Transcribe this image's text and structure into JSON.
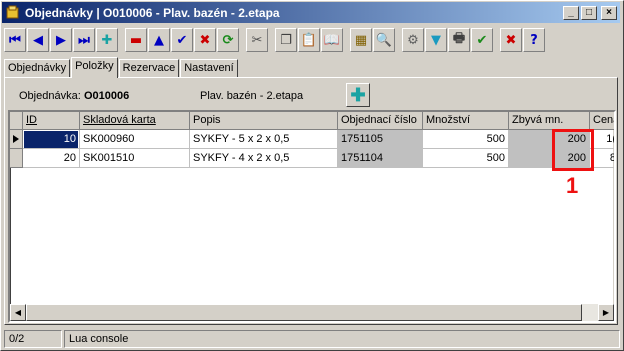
{
  "window": {
    "title": "Objednávky | O010006 - Plav. bazén - 2.etapa",
    "controls": {
      "minimize": "_",
      "maximize": "□",
      "close": "×"
    }
  },
  "toolbar": [
    {
      "name": "first-record-button",
      "glyph": "⏮",
      "color": "#0000c0"
    },
    {
      "name": "prev-record-button",
      "glyph": "◀",
      "color": "#0000c0"
    },
    {
      "name": "next-record-button",
      "glyph": "▶",
      "color": "#0000c0"
    },
    {
      "name": "last-record-button",
      "glyph": "⏭",
      "color": "#0000c0"
    },
    {
      "name": "add-record-button",
      "glyph": "✚",
      "color": "#1aa3a3"
    },
    {
      "name": "delete-record-button",
      "glyph": "▬",
      "color": "#cc0000"
    },
    {
      "name": "up-button",
      "glyph": "▲",
      "color": "#0000c0"
    },
    {
      "name": "confirm-button",
      "glyph": "✔",
      "color": "#0000c0"
    },
    {
      "name": "cancel-edit-button",
      "glyph": "✖",
      "color": "#cc0000"
    },
    {
      "name": "refresh-button",
      "glyph": "⟳",
      "color": "#1a8a1a"
    },
    {
      "name": "cut-button",
      "glyph": "✂",
      "color": "#505050"
    },
    {
      "name": "copy-button",
      "glyph": "❐",
      "color": "#404040"
    },
    {
      "name": "paste-button",
      "glyph": "📋",
      "color": "#806000"
    },
    {
      "name": "book-button",
      "glyph": "📖",
      "color": "#404040"
    },
    {
      "name": "tree-button",
      "glyph": "▦",
      "color": "#806000"
    },
    {
      "name": "search-button",
      "glyph": "🔍",
      "color": "#404040"
    },
    {
      "name": "settings-button",
      "glyph": "⚙",
      "color": "#606060"
    },
    {
      "name": "filter-button",
      "glyph": "▼",
      "color": "#1a9ac0"
    },
    {
      "name": "print-button",
      "glyph": "🖶",
      "color": "#404040"
    },
    {
      "name": "ok-button",
      "glyph": "✔",
      "color": "#1a8a1a"
    },
    {
      "name": "close-form-button",
      "glyph": "✖",
      "color": "#cc0000"
    },
    {
      "name": "help-button",
      "glyph": "?",
      "color": "#0000c0"
    }
  ],
  "tabs": [
    "Objednávky",
    "Položky",
    "Rezervace",
    "Nastavení"
  ],
  "active_tab": 1,
  "header": {
    "order_label": "Objednávka:",
    "order_value": "O010006",
    "project": "Plav. bazén - 2.etapa"
  },
  "grid": {
    "columns": [
      "ID",
      "Skladová karta",
      "Popis",
      "Objednací číslo",
      "Množství",
      "Zbyvá mn.",
      "Cena"
    ],
    "rows": [
      {
        "id": "10",
        "card": "SK000960",
        "desc": "SYKFY -  5 x 2 x 0,5",
        "order_no": "1751105",
        "qty": "500",
        "remaining": "200",
        "price": "1("
      },
      {
        "id": "20",
        "card": "SK001510",
        "desc": "SYKFY -  4 x 2 x 0,5",
        "order_no": "1751104",
        "qty": "500",
        "remaining": "200",
        "price": "8"
      }
    ],
    "scroll": {
      "left": "◀",
      "right": "▶"
    }
  },
  "status": {
    "record": "0/2",
    "console": "Lua console"
  },
  "annotation": {
    "label": "1",
    "color": "#ee1111"
  }
}
